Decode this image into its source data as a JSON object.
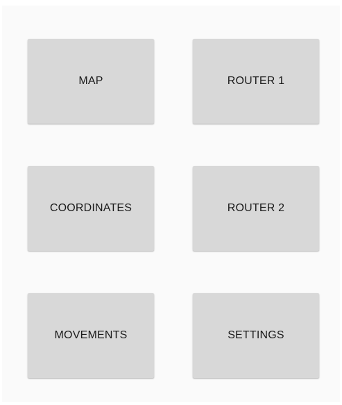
{
  "menu": {
    "map_label": "MAP",
    "router1_label": "ROUTER 1",
    "coordinates_label": "COORDINATES",
    "router2_label": "ROUTER 2",
    "movements_label": "MOVEMENTS",
    "settings_label": "SETTINGS"
  },
  "colors": {
    "background": "#fafafa",
    "button": "#d8d8d8",
    "text": "#1a1a1a"
  }
}
